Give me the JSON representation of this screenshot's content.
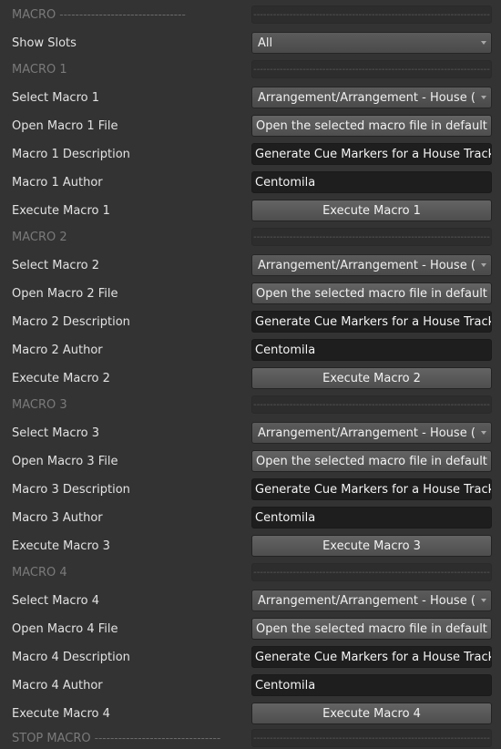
{
  "header": {
    "label": "MACRO",
    "dashes": "--------------------------------"
  },
  "show_slots": {
    "label": "Show Slots",
    "value": "All"
  },
  "separator_dashes": "------------------------------------------------------------------------",
  "macros": [
    {
      "section": "MACRO 1",
      "select_label": "Select Macro 1",
      "select_value": "Arrangement/Arrangement - House (C...",
      "open_label": "Open Macro 1 File",
      "open_button": "Open the selected macro file in default e...",
      "desc_label": "Macro 1 Description",
      "desc_value": "Generate Cue Markers for a House Track",
      "author_label": "Macro 1 Author",
      "author_value": "Centomila",
      "execute_label": "Execute Macro 1",
      "execute_button": "Execute Macro 1"
    },
    {
      "section": "MACRO 2",
      "select_label": "Select Macro 2",
      "select_value": "Arrangement/Arrangement - House (C...",
      "open_label": "Open Macro 2 File",
      "open_button": "Open the selected macro file in default e...",
      "desc_label": "Macro 2 Description",
      "desc_value": "Generate Cue Markers for a House Track",
      "author_label": "Macro 2 Author",
      "author_value": "Centomila",
      "execute_label": "Execute Macro 2",
      "execute_button": "Execute Macro 2"
    },
    {
      "section": "MACRO 3",
      "select_label": "Select Macro 3",
      "select_value": "Arrangement/Arrangement - House (C...",
      "open_label": "Open Macro 3 File",
      "open_button": "Open the selected macro file in default e...",
      "desc_label": "Macro 3 Description",
      "desc_value": "Generate Cue Markers for a House Track",
      "author_label": "Macro 3 Author",
      "author_value": "Centomila",
      "execute_label": "Execute Macro 3",
      "execute_button": "Execute Macro 3"
    },
    {
      "section": "MACRO 4",
      "select_label": "Select Macro 4",
      "select_value": "Arrangement/Arrangement - House (C...",
      "open_label": "Open Macro 4 File",
      "open_button": "Open the selected macro file in default e...",
      "desc_label": "Macro 4 Description",
      "desc_value": "Generate Cue Markers for a House Track",
      "author_label": "Macro 4 Author",
      "author_value": "Centomila",
      "execute_label": "Execute Macro 4",
      "execute_button": "Execute Macro 4"
    }
  ],
  "footer": {
    "label": "STOP MACRO",
    "dashes": "--------------------------------"
  }
}
